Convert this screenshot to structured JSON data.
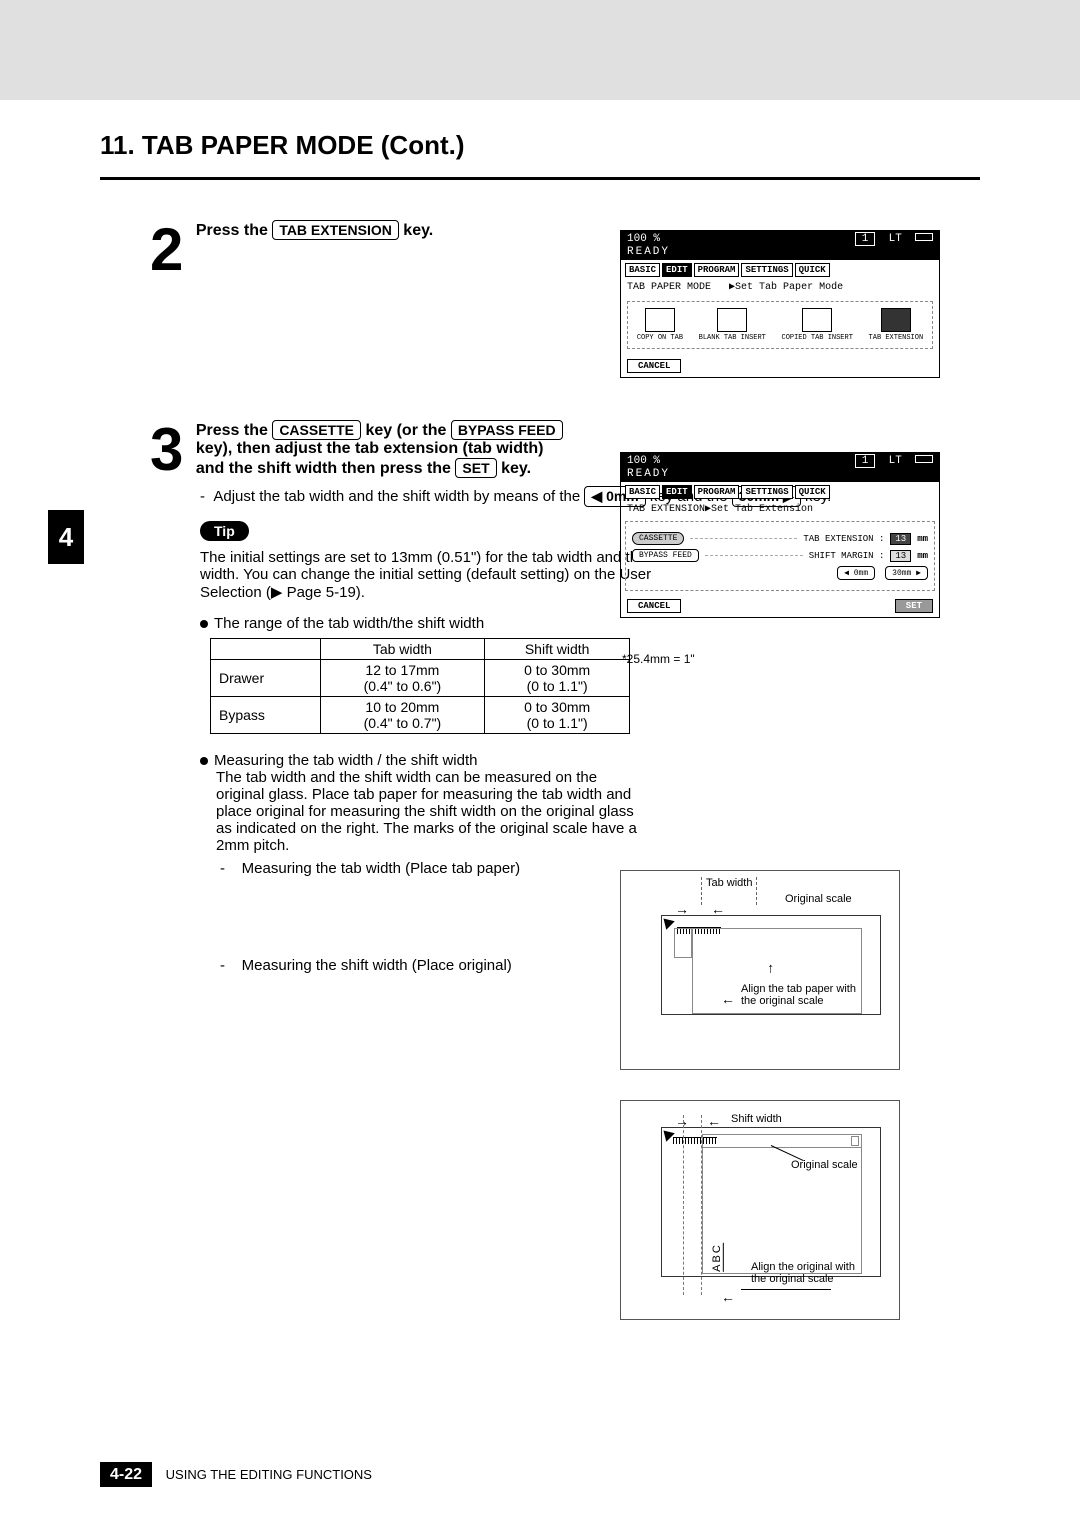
{
  "section_title": "11. TAB PAPER MODE (Cont.)",
  "side_tab": "4",
  "step2": {
    "number": "2",
    "prefix": "Press the ",
    "key": "TAB EXTENSION",
    "suffix": " key."
  },
  "step3": {
    "number": "3",
    "line": "Press the CASSETTE key (or the BYPASS FEED key), then adjust the tab extension (tab width) and the shift width then press the SET key.",
    "key1": "CASSETTE",
    "key2": "BYPASS FEED",
    "key3": "SET",
    "sub": "Adjust the tab width and the shift width by means of the",
    "sub_key1": "◀ 0mm",
    "sub_key2": "30mm ▶",
    "sub_mid": " key and the ",
    "sub_end": " key."
  },
  "tip_label": "Tip",
  "tip_body": "The initial settings are set to 13mm (0.51\") for the tab width and the shift width. You can change the initial setting (default setting) on the User Selection (▶ Page 5-19).",
  "range_heading": "The range of the tab width/the shift width",
  "range_table": {
    "headers": [
      "",
      "Tab width",
      "Shift width"
    ],
    "rows": [
      [
        "Drawer",
        "12 to 17mm\n(0.4\" to 0.6\")",
        "0 to 30mm\n(0 to 1.1\")"
      ],
      [
        "Bypass",
        "10 to 20mm\n(0.4\" to 0.7\")",
        "0 to 30mm\n(0 to 1.1\")"
      ]
    ]
  },
  "measure_heading": "Measuring the tab width / the shift width",
  "measure_body": "The tab width and the shift width can be measured on the original glass. Place tab paper for measuring the tab width and place original for measuring the shift width on the original glass as indicated on the right. The marks of the original scale have a 2mm pitch.",
  "measure_item1": "Measuring the tab width (Place tab paper)",
  "measure_item2": "Measuring the shift width (Place original)",
  "panel_ready": "READY",
  "panel_zoom": "100  %",
  "panel_count": "1",
  "panel_media": "LT",
  "panel_tabs": [
    "BASIC",
    "EDIT",
    "PROGRAM",
    "SETTINGS",
    "QUICK"
  ],
  "panel1": {
    "crumb_left": "TAB PAPER MODE",
    "crumb_right": "▶Set Tab Paper Mode",
    "modes": [
      "COPY ON TAB",
      "BLANK TAB INSERT",
      "COPIED TAB INSERT",
      "TAB EXTENSION"
    ],
    "cancel": "CANCEL"
  },
  "panel2": {
    "crumb_left": "TAB EXTENSION",
    "crumb_right": "▶Set Tab Extension",
    "cassette": "CASSETTE",
    "bypass": "BYPASS FEED",
    "tabext_label": "TAB EXTENSION :",
    "shift_label": "SHIFT MARGIN :",
    "val13": "13",
    "unit": "mm",
    "btn0": "◀   0mm",
    "btn30": "30mm  ▶",
    "cancel": "CANCEL",
    "set": "SET"
  },
  "footnote": "*25.4mm = 1\"",
  "diagram1": {
    "tabwidth": "Tab width",
    "origscale": "Original scale",
    "align": "Align the tab paper with\nthe original scale"
  },
  "diagram2": {
    "shiftwidth": "Shift width",
    "origscale": "Original scale",
    "abc": "ABC",
    "align": "Align the original with\nthe original scale"
  },
  "footer": {
    "page": "4-22",
    "chapter": "USING THE EDITING FUNCTIONS"
  }
}
